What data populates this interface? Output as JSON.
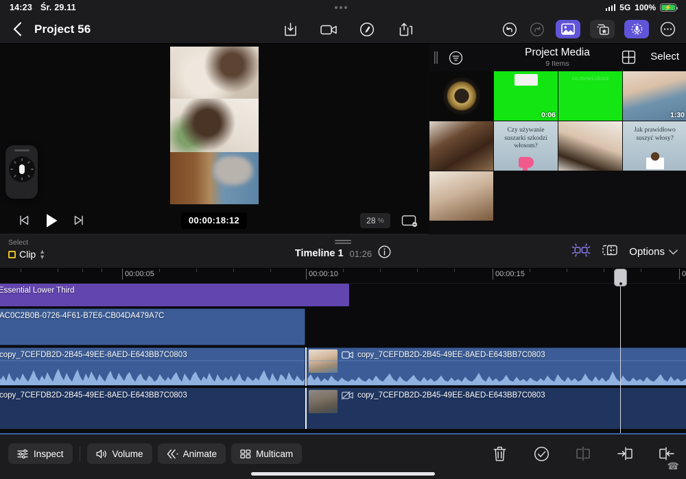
{
  "statusbar": {
    "time": "14:23",
    "date": "Śr. 29.11",
    "network": "5G",
    "battery": "100%",
    "signal_icon": "cellular-signal-icon",
    "battery_icon": "battery-charging-icon"
  },
  "navbar": {
    "back_icon": "chevron-left-icon",
    "title": "Project 56",
    "center_tools": [
      {
        "name": "import-media-button",
        "icon": "import-icon"
      },
      {
        "name": "record-video-button",
        "icon": "video-camera-icon"
      },
      {
        "name": "voiceover-button",
        "icon": "voiceover-icon"
      },
      {
        "name": "share-button",
        "icon": "share-export-icon"
      }
    ],
    "right_tools": [
      {
        "name": "undo-button",
        "icon": "undo-icon",
        "state": "enabled"
      },
      {
        "name": "redo-button",
        "icon": "redo-icon",
        "state": "disabled"
      },
      {
        "name": "media-browser-button",
        "icon": "photo-icon",
        "state": "active"
      },
      {
        "name": "effects-button",
        "icon": "effects-star-icon",
        "state": "inactive"
      },
      {
        "name": "audio-button",
        "icon": "microphone-icon",
        "state": "active"
      },
      {
        "name": "more-button",
        "icon": "ellipsis-circle-icon",
        "state": "enabled"
      }
    ]
  },
  "preview": {
    "name": "video-preview",
    "jog_widget": "jog-dial-widget"
  },
  "transport": {
    "skip_back_icon": "skip-to-start-icon",
    "play_icon": "play-icon",
    "skip_forward_icon": "skip-to-end-icon",
    "timecode": "00:00:18:12",
    "zoom_value": "28",
    "zoom_unit": "%",
    "screen_icon": "display-mode-icon"
  },
  "browser": {
    "filter_icon": "filter-list-icon",
    "title": "Project Media",
    "subtitle": "9 Items",
    "grid_icon": "grid-view-icon",
    "select_label": "Select",
    "items": [
      {
        "name": "media-item-certificate",
        "style": "c-badge",
        "overlay": "",
        "duration": ""
      },
      {
        "name": "media-item-green-1",
        "style": "c-green",
        "overlay": "",
        "duration": "0:06"
      },
      {
        "name": "media-item-green-2",
        "style": "c-green2",
        "overlay": "co.mowi.skora",
        "duration": ""
      },
      {
        "name": "media-item-woman-blue",
        "style": "c-woman1",
        "overlay": "",
        "duration": "1:30"
      },
      {
        "name": "media-item-hair-brush",
        "style": "c-hair",
        "overlay": "",
        "duration": ""
      },
      {
        "name": "media-item-question-dryer",
        "style": "c-blue",
        "overlay": "Czy używanie suszarki szkodzi włosom?",
        "duration": ""
      },
      {
        "name": "media-item-hands-hair",
        "style": "c-hands",
        "overlay": "",
        "duration": ""
      },
      {
        "name": "media-item-question-dry",
        "style": "c-blue",
        "overlay": "Jak prawidłowo suszyć włosy?",
        "duration": ""
      },
      {
        "name": "media-item-towel",
        "style": "c-last",
        "overlay": "",
        "duration": ""
      }
    ]
  },
  "timeline_toolbar": {
    "select_label": "Select",
    "select_value": "Clip",
    "timeline_name": "Timeline 1",
    "timeline_duration": "01:26",
    "info_icon": "info-circle-icon",
    "snap_icon": "snapping-icon",
    "split_icon": "split-clip-icon",
    "options_label": "Options",
    "options_chevron": "chevron-down-icon"
  },
  "timeline": {
    "ruler_labels": [
      "00:00:05",
      "00:00:10",
      "00:00:15",
      "0"
    ],
    "playhead_position_label": "playhead",
    "tracks": [
      {
        "name": "title-track",
        "clips": [
          {
            "name": "title-clip",
            "label": "Essential Lower Third",
            "type": "title"
          }
        ]
      },
      {
        "name": "overlay-track",
        "clips": [
          {
            "name": "overlay-clip",
            "label": "AC0C2B0B-0726-4F61-B7E6-CB04DA479A7C",
            "type": "video"
          }
        ]
      },
      {
        "name": "main-video-track",
        "clips": [
          {
            "name": "main-clip-1",
            "label": "copy_7CEFDB2D-2B45-49EE-8AED-E643BB7C0803",
            "type": "video-audio",
            "icon": ""
          },
          {
            "name": "main-clip-2",
            "label": "copy_7CEFDB2D-2B45-49EE-8AED-E643BB7C0803",
            "type": "video-audio",
            "icon": "video-camera-icon"
          }
        ]
      },
      {
        "name": "secondary-video-track",
        "clips": [
          {
            "name": "secondary-clip-1",
            "label": "copy_7CEFDB2D-2B45-49EE-8AED-E643BB7C0803",
            "type": "video-muted",
            "icon": ""
          },
          {
            "name": "secondary-clip-2",
            "label": "copy_7CEFDB2D-2B45-49EE-8AED-E643BB7C0803",
            "type": "video-muted",
            "icon": "video-camera-off-icon"
          }
        ]
      }
    ]
  },
  "bottombar": {
    "left_buttons": [
      {
        "name": "inspect-button",
        "label": "Inspect",
        "icon": "sliders-icon"
      },
      {
        "name": "volume-button",
        "label": "Volume",
        "icon": "speaker-icon"
      },
      {
        "name": "animate-button",
        "label": "Animate",
        "icon": "animate-chevrons-icon"
      },
      {
        "name": "multicam-button",
        "label": "Multicam",
        "icon": "multicam-grid-icon"
      }
    ],
    "right_icons": [
      {
        "name": "delete-button",
        "icon": "trash-icon",
        "state": "enabled"
      },
      {
        "name": "confirm-button",
        "icon": "checkmark-circle-icon",
        "state": "enabled"
      },
      {
        "name": "split-button",
        "icon": "split-icon",
        "state": "disabled"
      },
      {
        "name": "trim-start-button",
        "icon": "trim-start-icon",
        "state": "enabled"
      },
      {
        "name": "trim-end-button",
        "icon": "trim-end-icon",
        "state": "enabled"
      }
    ]
  },
  "colors": {
    "accent_purple": "#6054d8",
    "title_clip": "#6345b0",
    "video_clip": "#3b5c96",
    "select_yellow": "#e6c229",
    "battery_green": "#34c759"
  }
}
